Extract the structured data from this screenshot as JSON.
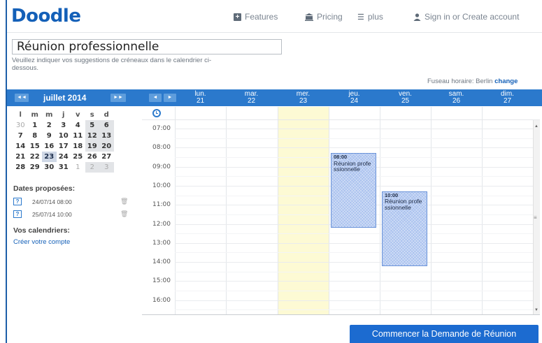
{
  "header": {
    "logo": "Doodle",
    "nav": {
      "features": "Features",
      "pricing": "Pricing",
      "plus": "plus",
      "signin": "Sign in or Create account"
    }
  },
  "poll": {
    "title": "Réunion professionnelle",
    "subtitle": "Veuillez indiquer vos suggestions de créneaux dans le calendrier ci-dessous.",
    "timezone_label": "Fuseau horaire: Berlin",
    "timezone_change": "change"
  },
  "mini_calendar": {
    "month": "juillet 2014",
    "prev": "◄◄",
    "next": "►►",
    "weekday_headers": [
      "l",
      "m",
      "m",
      "j",
      "v",
      "s",
      "d"
    ],
    "weeks": [
      [
        "30",
        "1",
        "2",
        "3",
        "4",
        "5",
        "6"
      ],
      [
        "7",
        "8",
        "9",
        "10",
        "11",
        "12",
        "13"
      ],
      [
        "14",
        "15",
        "16",
        "17",
        "18",
        "19",
        "20"
      ],
      [
        "21",
        "22",
        "23",
        "24",
        "25",
        "26",
        "27"
      ],
      [
        "28",
        "29",
        "30",
        "31",
        "1",
        "2",
        "3"
      ]
    ]
  },
  "proposed": {
    "heading": "Dates proposées:",
    "items": [
      {
        "badge": "?",
        "text": "24/07/14 08:00"
      },
      {
        "badge": "?",
        "text": "25/07/14 10:00"
      }
    ]
  },
  "calendars": {
    "heading": "Vos calendriers:",
    "link": "Créer votre compte"
  },
  "week": {
    "prev": "◄",
    "next": "►",
    "days": [
      {
        "name": "lun.",
        "date": "21"
      },
      {
        "name": "mar.",
        "date": "22"
      },
      {
        "name": "mer.",
        "date": "23"
      },
      {
        "name": "jeu.",
        "date": "24"
      },
      {
        "name": "ven.",
        "date": "25"
      },
      {
        "name": "sam.",
        "date": "26"
      },
      {
        "name": "dim.",
        "date": "27"
      }
    ],
    "hours": [
      "07:00",
      "08:00",
      "09:00",
      "10:00",
      "11:00",
      "12:00",
      "13:00",
      "14:00",
      "15:00",
      "16:00"
    ],
    "events": [
      {
        "day_index": 3,
        "start_hour": 8.0,
        "end_hour": 12.0,
        "time": "08:00",
        "title": "Réunion professionnelle"
      },
      {
        "day_index": 4,
        "start_hour": 10.0,
        "end_hour": 14.0,
        "time": "10:00",
        "title": "Réunion professionnelle"
      }
    ]
  },
  "actions": {
    "start": "Commencer la Demande de Réunion"
  },
  "colors": {
    "brand": "#1460b8",
    "bar": "#2b79cc",
    "today": "#fdfad4",
    "event": "#a9c1ee",
    "button": "#1c6bd0"
  }
}
